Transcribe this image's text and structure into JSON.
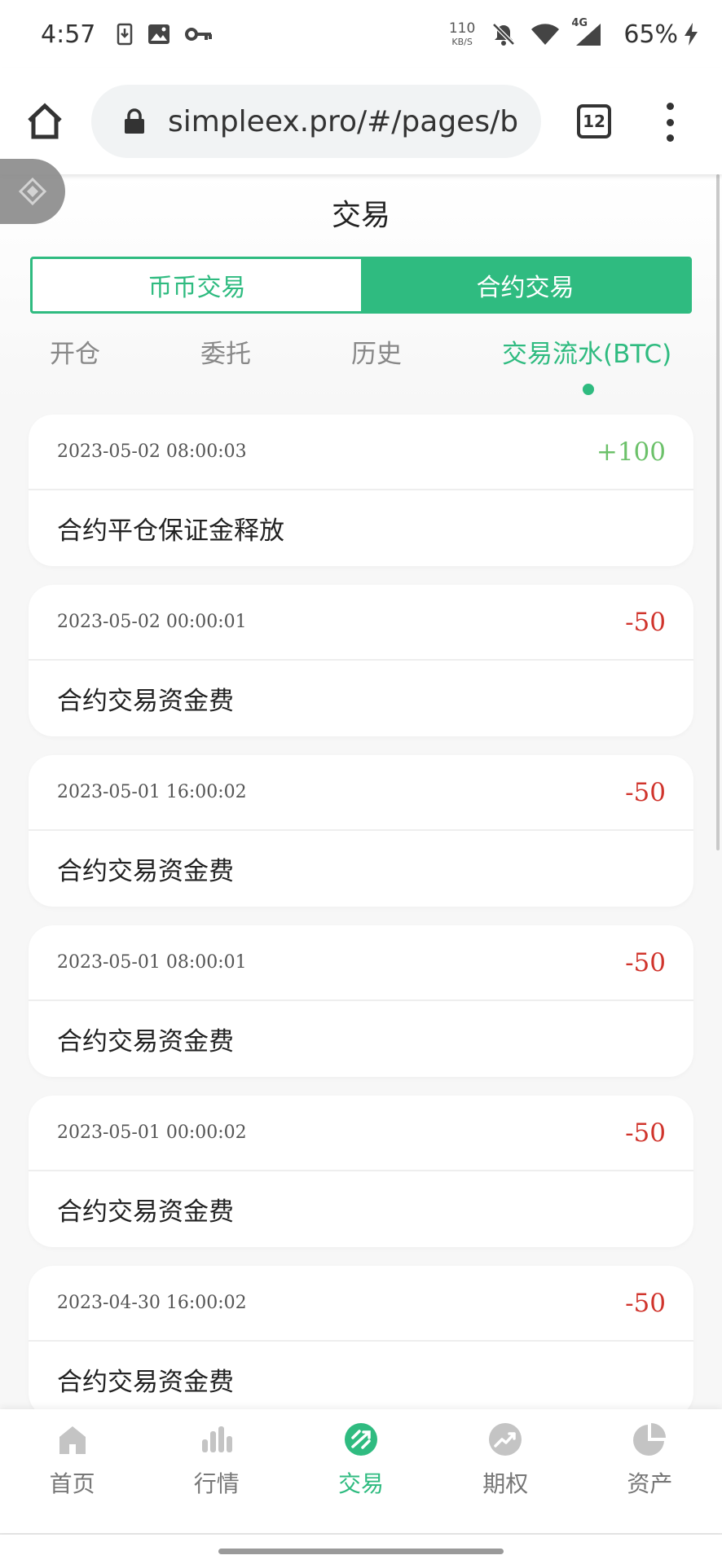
{
  "status_bar": {
    "time": "4:57",
    "net_speed_value": "110",
    "net_speed_unit": "KB/S",
    "network_type": "4G",
    "battery": "65%"
  },
  "browser": {
    "url": "simpleex.pro/#/pages/bas",
    "tab_count": "12"
  },
  "page": {
    "title": "交易",
    "segments": [
      "币币交易",
      "合约交易"
    ],
    "active_segment": "合约交易",
    "subtabs": [
      "开仓",
      "委托",
      "历史",
      "交易流水(BTC)"
    ],
    "active_subtab": "交易流水(BTC)"
  },
  "records": [
    {
      "time": "2023-05-02 08:00:03",
      "amount": "+100",
      "desc": "合约平仓保证金释放"
    },
    {
      "time": "2023-05-02 00:00:01",
      "amount": "-50",
      "desc": "合约交易资金费"
    },
    {
      "time": "2023-05-01 16:00:02",
      "amount": "-50",
      "desc": "合约交易资金费"
    },
    {
      "time": "2023-05-01 08:00:01",
      "amount": "-50",
      "desc": "合约交易资金费"
    },
    {
      "time": "2023-05-01 00:00:02",
      "amount": "-50",
      "desc": "合约交易资金费"
    },
    {
      "time": "2023-04-30 16:00:02",
      "amount": "-50",
      "desc": "合约交易资金费"
    }
  ],
  "bottom_nav": [
    {
      "label": "首页",
      "icon": "home-icon"
    },
    {
      "label": "行情",
      "icon": "market-bars-icon"
    },
    {
      "label": "交易",
      "icon": "trade-icon"
    },
    {
      "label": "期权",
      "icon": "options-trend-icon"
    },
    {
      "label": "资产",
      "icon": "assets-pie-icon"
    }
  ],
  "active_nav": "交易",
  "colors": {
    "accent": "#2fbb80",
    "positive": "#6cc16a",
    "negative": "#d0342c"
  }
}
